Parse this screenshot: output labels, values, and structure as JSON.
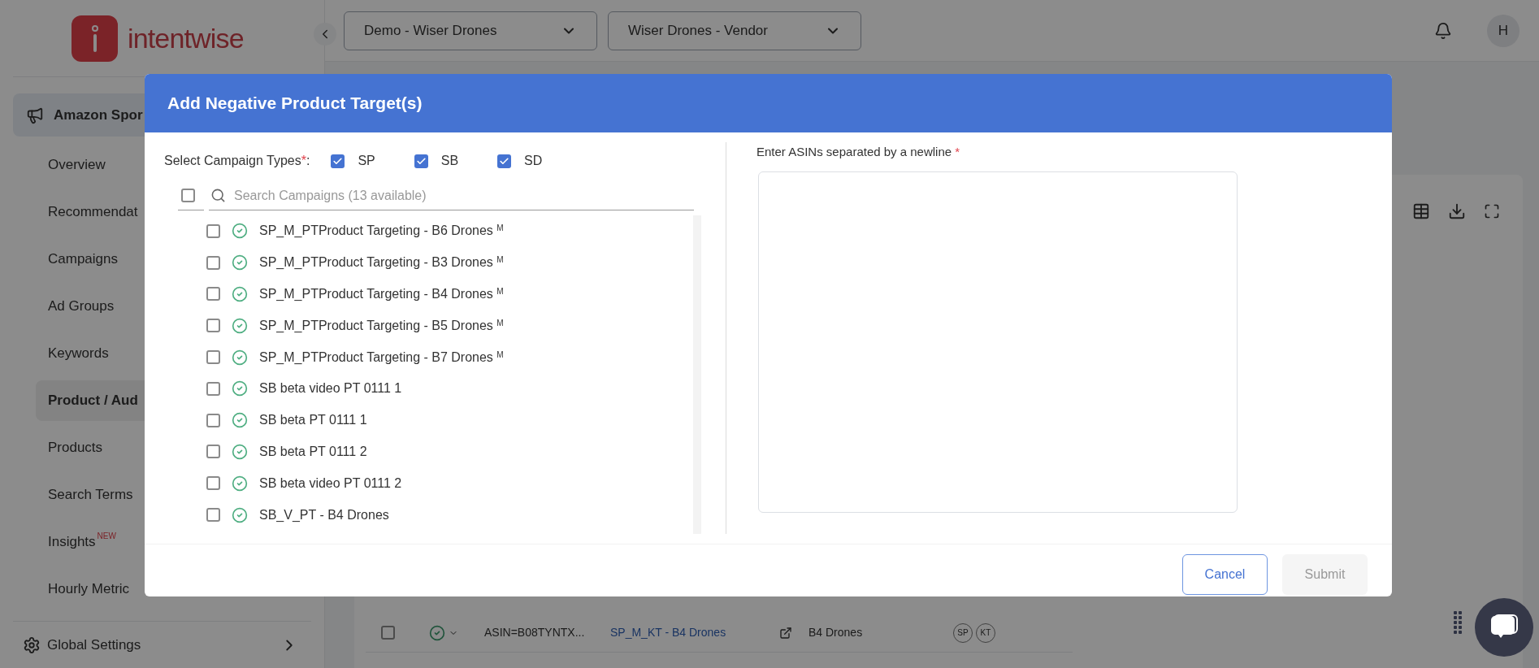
{
  "logo": {
    "text": "intentwise"
  },
  "header": {
    "selects": [
      {
        "value": "Demo - Wiser Drones"
      },
      {
        "value": "Wiser Drones - Vendor"
      }
    ],
    "avatar": "H"
  },
  "sidebar": {
    "section": {
      "label": "Amazon Spor",
      "selected": true
    },
    "items": [
      {
        "label": "Overview",
        "selected": false
      },
      {
        "label": "Recommendat",
        "selected": false
      },
      {
        "label": "Campaigns",
        "selected": false
      },
      {
        "label": "Ad Groups",
        "selected": false
      },
      {
        "label": "Keywords",
        "selected": false
      },
      {
        "label": "Product / Aud",
        "selected": true
      },
      {
        "label": "Products",
        "selected": false
      },
      {
        "label": "Search Terms",
        "selected": false
      },
      {
        "label": "Insights",
        "selected": false,
        "badge": "NEW"
      },
      {
        "label": "Hourly Metric",
        "selected": false
      }
    ],
    "footer": {
      "label": "Global Settings"
    }
  },
  "table": {
    "rows": [
      {
        "checked": false,
        "asin": "ASIN=B08TYNTX...",
        "campaign": "SP_M_KT - B4 Drones",
        "ad_group": "B4 Drones",
        "tags": [
          "SP",
          "KT"
        ]
      }
    ]
  },
  "modal": {
    "title": "Add Negative Product Target(s)",
    "campaign_types": {
      "label": "Select Campaign Types",
      "required_mark": "*",
      "suffix": ":",
      "options": [
        {
          "label": "SP",
          "checked": true
        },
        {
          "label": "SB",
          "checked": true
        },
        {
          "label": "SD",
          "checked": true
        }
      ]
    },
    "search": {
      "placeholder": "Search Campaigns (13 available)",
      "select_all": false
    },
    "campaigns": [
      {
        "name": "SP_M_PTProduct Targeting - B6 Drones $^{M}$",
        "checked": false
      },
      {
        "name": "SP_M_PTProduct Targeting - B3 Drones $^{M}$",
        "checked": false
      },
      {
        "name": "SP_M_PTProduct Targeting - B4 Drones $^{M}$",
        "checked": false
      },
      {
        "name": "SP_M_PTProduct Targeting - B5 Drones $^{M}$",
        "checked": false
      },
      {
        "name": "SP_M_PTProduct Targeting - B7 Drones $^{M}$",
        "checked": false
      },
      {
        "name": "SB beta video PT 0111 1",
        "checked": false
      },
      {
        "name": "SB beta PT 0111 1",
        "checked": false
      },
      {
        "name": "SB beta PT 0111 2",
        "checked": false
      },
      {
        "name": "SB beta video PT 0111 2",
        "checked": false
      },
      {
        "name": "SB_V_PT - B4 Drones",
        "checked": false
      }
    ],
    "asins": {
      "label": "Enter ASINs separated by a newline",
      "required_mark": "*"
    },
    "buttons": [
      {
        "label": "Cancel",
        "kind": "secondary",
        "disabled": false
      },
      {
        "label": "Submit",
        "kind": "primary",
        "disabled": true
      }
    ]
  }
}
